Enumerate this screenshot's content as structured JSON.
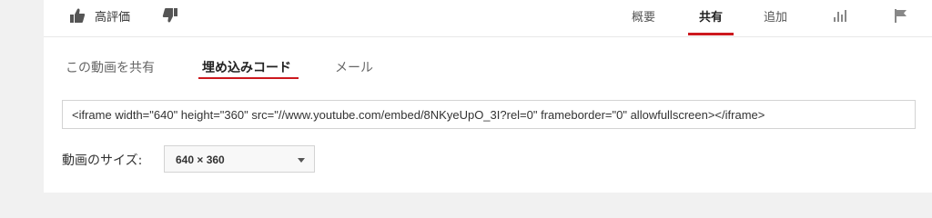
{
  "actions": {
    "like_label": "高評価",
    "like_icon": "thumbs-up-icon",
    "dislike_icon": "thumbs-down-icon"
  },
  "top_tabs": [
    {
      "label": "概要",
      "active": false
    },
    {
      "label": "共有",
      "active": true
    },
    {
      "label": "追加",
      "active": false
    },
    {
      "label": "",
      "icon": "stats-icon"
    },
    {
      "label": "",
      "icon": "flag-icon"
    }
  ],
  "share_tabs": [
    {
      "label": "この動画を共有",
      "active": false
    },
    {
      "label": "埋め込みコード",
      "active": true
    },
    {
      "label": "メール",
      "active": false
    }
  ],
  "embed": {
    "code": "<iframe width=\"640\" height=\"360\" src=\"//www.youtube.com/embed/8NKyeUpO_3I?rel=0\" frameborder=\"0\" allowfullscreen></iframe>"
  },
  "video_size": {
    "label": "動画のサイズ:",
    "selected": "640 × 360"
  },
  "colors": {
    "accent": "#cc181e",
    "background": "#f1f1f1",
    "panel": "#ffffff"
  }
}
